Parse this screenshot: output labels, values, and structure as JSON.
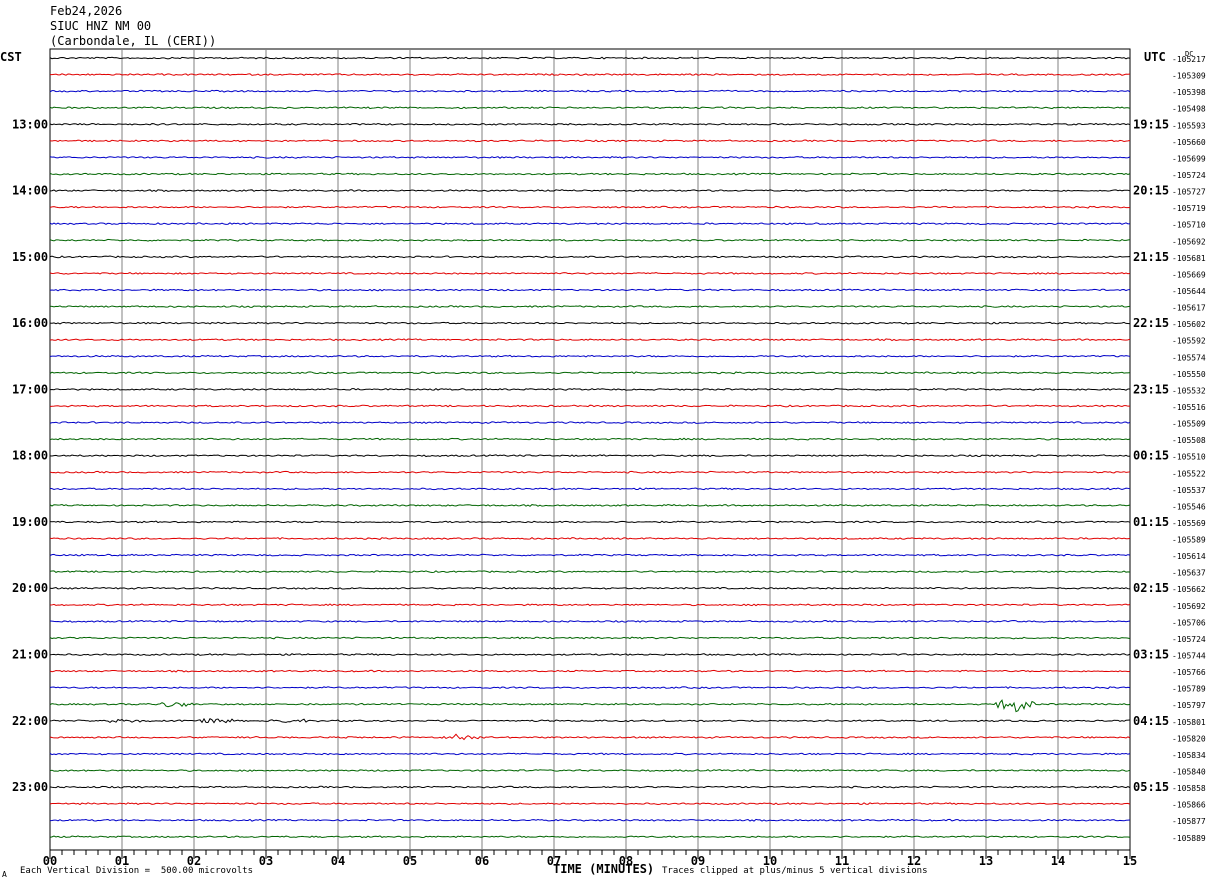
{
  "header": {
    "date": "Feb24,2026",
    "station": "SIUC HNZ NM 00",
    "location": "(Carbondale, IL (CERI))"
  },
  "footer": {
    "scale_note": "Each Vertical Division =  500.00 microvolts",
    "clip_note": "Traces clipped at plus/minus 5 vertical divisions",
    "corner_mark": "A"
  },
  "colors": {
    "trace_cycle": [
      "#000000",
      "#e00000",
      "#0000c8",
      "#006400"
    ],
    "grid": "#808080"
  },
  "chart_data": {
    "type": "line",
    "title": "",
    "xlabel": "TIME (MINUTES)",
    "left_axis_label": "CST",
    "right_axis_label": "UTC",
    "dc_label": "DC",
    "xlim": [
      0,
      15
    ],
    "x_ticks": [
      "00",
      "01",
      "02",
      "03",
      "04",
      "05",
      "06",
      "07",
      "08",
      "09",
      "10",
      "11",
      "12",
      "13",
      "14",
      "15"
    ],
    "grid": true,
    "traces_per_hour": 4,
    "left_hour_labels": [
      "13:00",
      "14:00",
      "15:00",
      "16:00",
      "17:00",
      "18:00",
      "19:00",
      "20:00",
      "21:00",
      "22:00",
      "23:00"
    ],
    "right_hour_labels": [
      "19:15",
      "20:15",
      "21:15",
      "22:15",
      "23:15",
      "00:15",
      "01:15",
      "02:15",
      "03:15",
      "04:15",
      "05:15"
    ],
    "dc_offsets": [
      "-105217",
      "-105309",
      "-105398",
      "-105498",
      "-105593",
      "-105660",
      "-105699",
      "-105724",
      "-105727",
      "-105719",
      "-105710",
      "-105692",
      "-105681",
      "-105669",
      "-105644",
      "-105617",
      "-105602",
      "-105592",
      "-105574",
      "-105550",
      "-105532",
      "-105516",
      "-105509",
      "-105508",
      "-105510",
      "-105522",
      "-105537",
      "-105546",
      "-105569",
      "-105589",
      "-105614",
      "-105637",
      "-105662",
      "-105692",
      "-105706",
      "-105724",
      "-105744",
      "-105766",
      "-105789",
      "-105797",
      "-105801",
      "-105820",
      "-105834",
      "-105840",
      "-105858",
      "-105866",
      "-105877",
      "-105889"
    ],
    "events": [
      {
        "trace": 39,
        "minute": 1.75,
        "amplitude": 0.5
      },
      {
        "trace": 39,
        "minute": 13.4,
        "amplitude": 1.2
      },
      {
        "trace": 40,
        "minute": 1.0,
        "amplitude": 0.4
      },
      {
        "trace": 40,
        "minute": 2.3,
        "amplitude": 0.4
      },
      {
        "trace": 40,
        "minute": 3.4,
        "amplitude": 0.3
      },
      {
        "trace": 41,
        "minute": 5.7,
        "amplitude": 0.5
      }
    ]
  }
}
